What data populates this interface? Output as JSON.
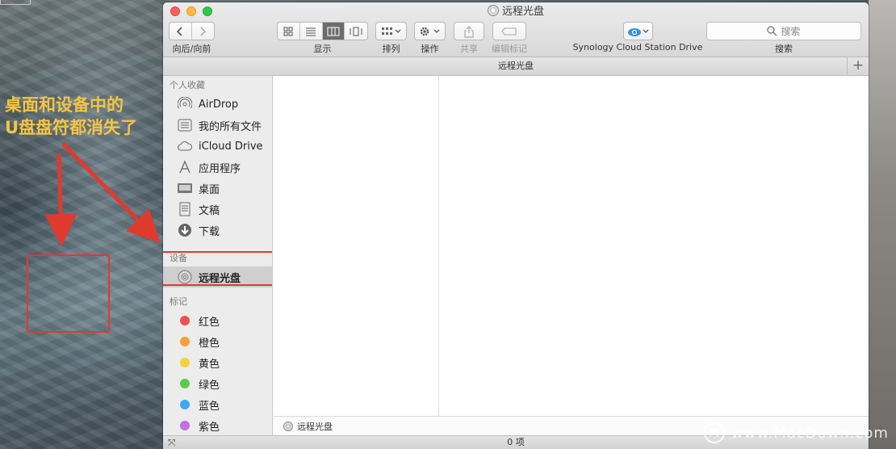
{
  "annotation": {
    "line1": "桌面和设备中的",
    "line2": "U盘盘符都消失了"
  },
  "window": {
    "title": "远程光盘"
  },
  "toolbar": {
    "nav_label": "向后/向前",
    "view_label": "显示",
    "arrange_label": "排列",
    "action_label": "操作",
    "share_label": "共享",
    "tags_label": "编辑标记",
    "cloud_label": "Synology Cloud Station Drive",
    "search_placeholder": "搜索",
    "search_label": "搜索"
  },
  "pathbar": {
    "title": "远程光盘"
  },
  "sidebar": {
    "favorites_header": "个人收藏",
    "favorites": [
      {
        "label": "AirDrop",
        "icon": "airdrop-icon"
      },
      {
        "label": "我的所有文件",
        "icon": "all-files-icon"
      },
      {
        "label": "iCloud Drive",
        "icon": "cloud-icon"
      },
      {
        "label": "应用程序",
        "icon": "applications-icon"
      },
      {
        "label": "桌面",
        "icon": "desktop-icon"
      },
      {
        "label": "文稿",
        "icon": "documents-icon"
      },
      {
        "label": "下载",
        "icon": "download-icon"
      }
    ],
    "devices_header": "设备",
    "devices": [
      {
        "label": "远程光盘",
        "icon": "disc-icon",
        "selected": true
      }
    ],
    "tags_header": "标记",
    "tags": [
      {
        "label": "红色",
        "color": "#f1504a"
      },
      {
        "label": "橙色",
        "color": "#f6a039"
      },
      {
        "label": "黄色",
        "color": "#f6d03b"
      },
      {
        "label": "绿色",
        "color": "#5ccb4a"
      },
      {
        "label": "蓝色",
        "color": "#3ea6f5"
      },
      {
        "label": "紫色",
        "color": "#c46fe0"
      }
    ]
  },
  "footer": {
    "path": "远程光盘",
    "status": "0 项"
  },
  "watermark": {
    "text": "www.MacDown.com"
  },
  "colors": {
    "annotation_text": "#f6c445",
    "annotation_red": "#e03a2e"
  }
}
